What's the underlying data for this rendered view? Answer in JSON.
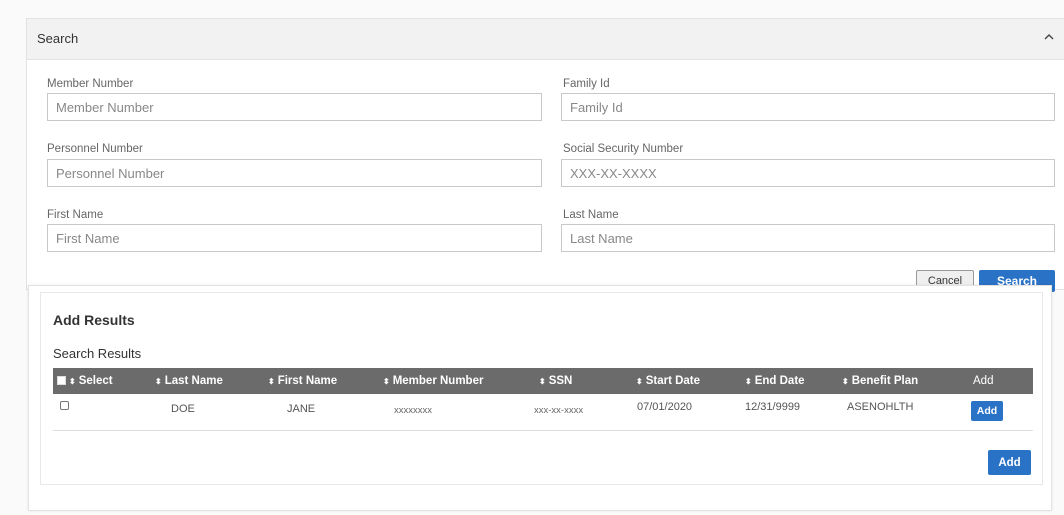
{
  "search": {
    "title": "Search",
    "fields": {
      "member_number": {
        "label": "Member Number",
        "placeholder": "Member Number"
      },
      "family_id": {
        "label": "Family Id",
        "placeholder": "Family Id"
      },
      "personnel_number": {
        "label": "Personnel Number",
        "placeholder": "Personnel Number"
      },
      "ssn": {
        "label": "Social Security Number",
        "placeholder": "XXX-XX-XXXX"
      },
      "first_name": {
        "label": "First Name",
        "placeholder": "First Name"
      },
      "last_name": {
        "label": "Last Name",
        "placeholder": "Last Name"
      }
    },
    "cancel_label": "Cancel",
    "search_label": "Search"
  },
  "results": {
    "title": "Add Results",
    "subtitle": "Search Results",
    "columns": [
      "Select",
      "Last Name",
      "First Name",
      "Member Number",
      "SSN",
      "Start Date",
      "End Date",
      "Benefit Plan",
      "Add"
    ],
    "rows": [
      {
        "last_name": "DOE",
        "first_name": "JANE",
        "member_number": "xxxxxxxx",
        "ssn": "xxx-xx-xxxx",
        "start_date": "07/01/2020",
        "end_date": "12/31/9999",
        "benefit_plan": "ASENOHLTH",
        "add_label": "Add"
      }
    ],
    "add_label": "Add"
  },
  "icons": {
    "collapse": "chevron-up-icon",
    "sort": "sort-icon"
  },
  "colors": {
    "primary": "#2a72c6",
    "table_header": "#6b6b6b"
  }
}
